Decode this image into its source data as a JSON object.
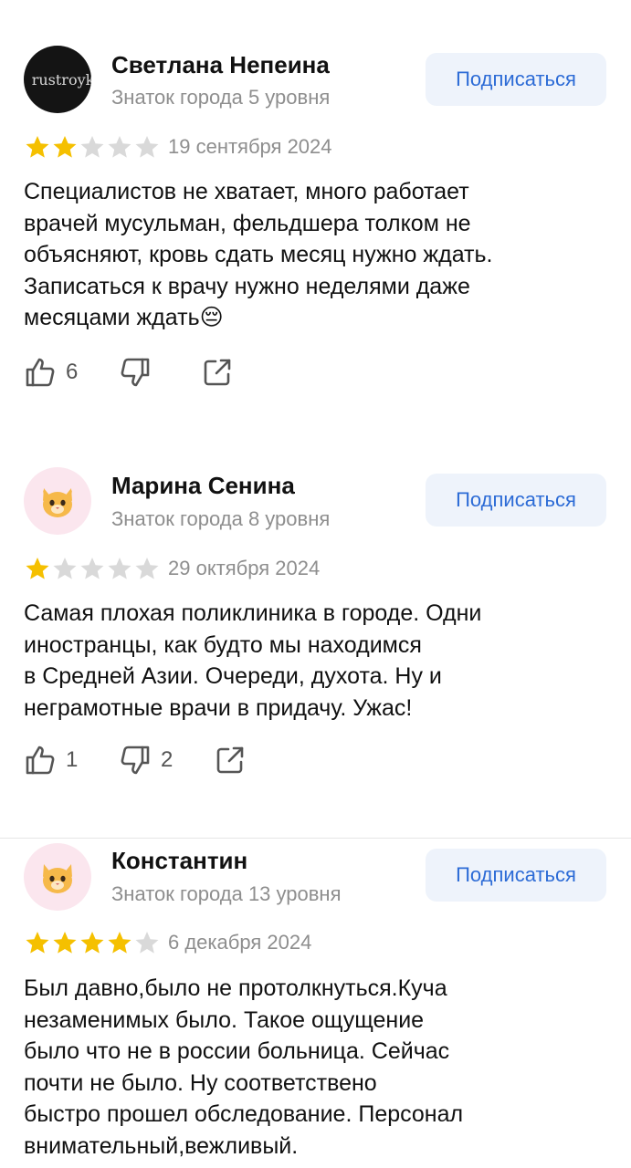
{
  "reviews": [
    {
      "name": "Светлана Непеина",
      "level": "Знаток города 5 уровня",
      "avatar_text": "rustroyk",
      "avatar_type": "photo",
      "subscribe_label": "Подписаться",
      "rating": 2,
      "date": "19 сентября 2024",
      "text_lines": [
        "Специалистов не хватает, много работает",
        "врачей мусульман, фельдшера толком не",
        "объясняют, кровь сдать месяц нужно ждать.",
        "Записаться к врачу нужно неделями даже",
        "месяцами  ждать😔"
      ],
      "likes": "6",
      "dislikes": ""
    },
    {
      "name": "Марина Сенина",
      "level": "Знаток города 8 уровня",
      "avatar_type": "cat",
      "avatar_emoji": "🐱",
      "subscribe_label": "Подписаться",
      "rating": 1,
      "date": "29 октября 2024",
      "text_lines": [
        "Самая плохая поликлиника в городе. Одни",
        "иностранцы, как будто мы находимся",
        "в Средней Азии. Очереди, духота. Ну и",
        "неграмотные врачи в придачу. Ужас!"
      ],
      "likes": "1",
      "dislikes": "2"
    },
    {
      "name": "Константин",
      "level": "Знаток города 13 уровня",
      "avatar_type": "cat",
      "avatar_emoji": "🐱",
      "subscribe_label": "Подписаться",
      "rating": 4,
      "date": "6 декабря 2024",
      "text_lines": [
        "Был давно,было не протолкнуться.Куча",
        "незаменимых было. Такое ощущение",
        "было что не в россии больница. Сейчас",
        "почти не было. Ну  соответствено",
        "быстро прошел обследование. Персонал",
        "внимательный,вежливый."
      ]
    }
  ],
  "colors": {
    "star_filled": "#f5c000",
    "star_empty": "#d9d9d9",
    "accent": "#2c6bd6"
  },
  "icons": {
    "like": "thumbs-up-icon",
    "dislike": "thumbs-down-icon",
    "share": "share-icon"
  }
}
